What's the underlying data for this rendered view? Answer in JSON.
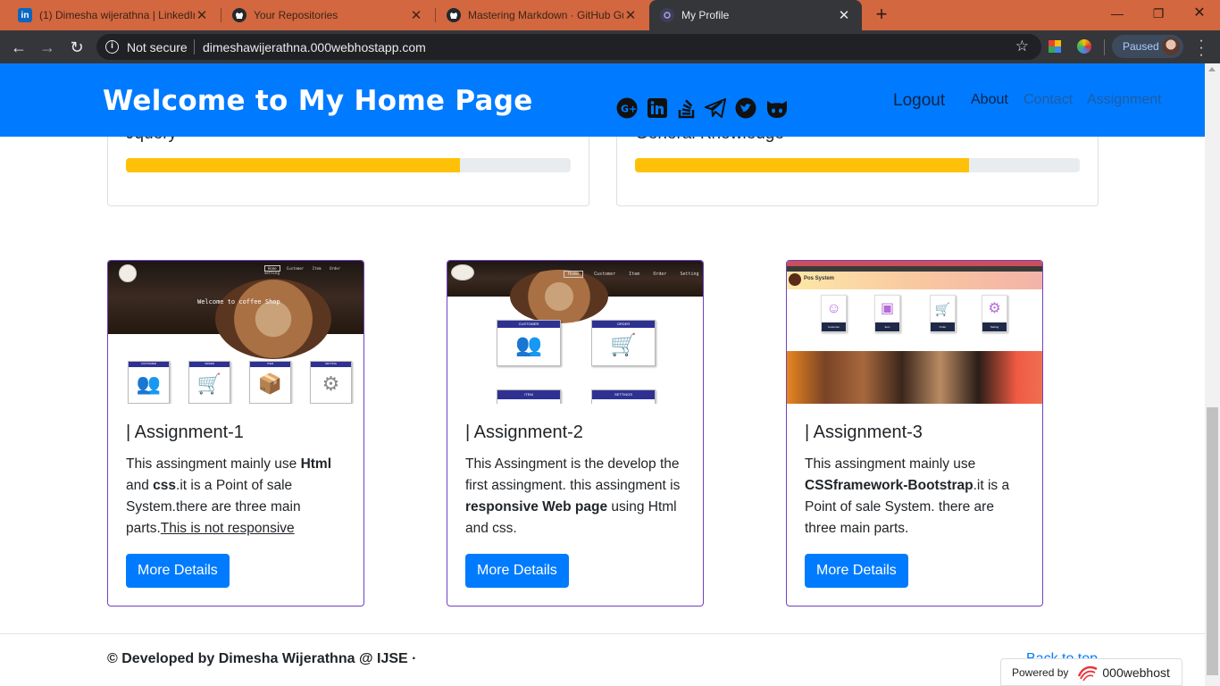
{
  "browser": {
    "tabs": [
      {
        "title": "(1) Dimesha wijerathna | LinkedIn",
        "icon": "linkedin-icon",
        "active": false
      },
      {
        "title": "Your Repositories",
        "icon": "github-icon",
        "active": false
      },
      {
        "title": "Mastering Markdown · GitHub Gu",
        "icon": "github-icon",
        "active": false
      },
      {
        "title": "My Profile",
        "icon": "site-icon",
        "active": true
      }
    ],
    "security_label": "Not secure",
    "url": "dimeshawijerathna.000webhostapp.com",
    "profile_status": "Paused",
    "colors": {
      "tabbar": "#d3673f",
      "toolbar": "#35363a"
    }
  },
  "page": {
    "brand": "Welcome to My Home Page",
    "social_icons": [
      "google-plus-icon",
      "linkedin-icon",
      "stackoverflow-icon",
      "telegram-icon",
      "twitter-icon",
      "github-icon"
    ],
    "nav": {
      "logout": "Logout",
      "about": "About",
      "contact": "Contact",
      "assignment": "Assignment"
    },
    "skills": [
      {
        "label": "Jquery",
        "progress": 0.75
      },
      {
        "label": "General Knowledge",
        "progress": 0.75
      }
    ],
    "assignments": [
      {
        "title": "| Assignment-1",
        "text_parts": [
          "This assingment mainly use ",
          "Html",
          " and ",
          "css",
          ".it is a Point of sale System.there are three main parts.",
          "This is not responsive"
        ],
        "button": "More Details",
        "thumb": {
          "menu": [
            "Home",
            "Customer",
            "Item",
            "Order",
            "Setting"
          ],
          "welcome": "Welcome to coffee Shop",
          "cards": [
            "CUSTOMER",
            "ORDER",
            "ITEM",
            "SETTING"
          ]
        }
      },
      {
        "title": "| Assignment-2",
        "text_parts": [
          "This Assingment is the develop the first assingment. this assingment is ",
          "responsive Web page",
          " using Html and css."
        ],
        "button": "More Details",
        "thumb": {
          "menu": [
            "Home",
            "Customer",
            "Item",
            "Order",
            "Setting"
          ],
          "cards": [
            "CUSTOMER",
            "ORDER",
            "ITEM",
            "SETTINGS"
          ]
        }
      },
      {
        "title": "| Assignment-3",
        "text_parts": [
          "This assingment mainly use ",
          "CSSframework-Bootstrap",
          ".it is a Point of sale System. there are three main parts."
        ],
        "button": "More Details",
        "thumb": {
          "title": "Pos System",
          "cards": [
            "Customer",
            "Item",
            "Order",
            "Setting"
          ]
        }
      }
    ],
    "footer": {
      "text": "© Developed by Dimesha Wijerathna @ IJSE ·",
      "back_to_top": "Back to top",
      "powered_by": "Powered by",
      "host": "000webhost"
    },
    "colors": {
      "primary": "#007bff",
      "warning": "#ffc107",
      "card_border": "#6f42c1"
    }
  }
}
